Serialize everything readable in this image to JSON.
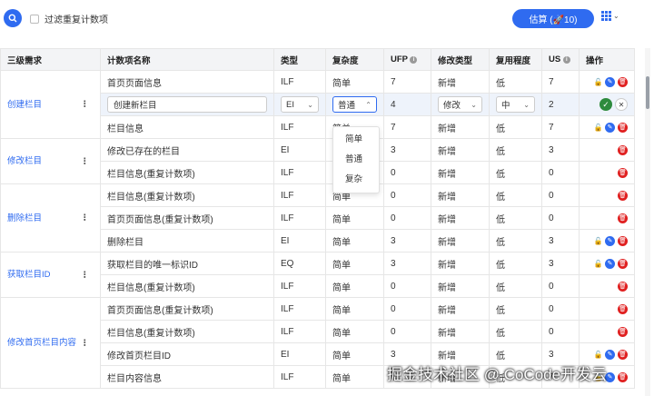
{
  "toolbar": {
    "filter_label": "过滤重复计数项",
    "estimate_label": "估算 (🚀10)"
  },
  "table": {
    "headers": {
      "req": "三级需求",
      "name": "计数项名称",
      "type": "类型",
      "complexity": "复杂度",
      "ufp": "UFP",
      "modify_type": "修改类型",
      "reuse": "复用程度",
      "us": "US",
      "ops": "操作"
    },
    "groups": {
      "g1": "创建栏目",
      "g2": "修改栏目",
      "g3": "删除栏目",
      "g4": "获取栏目ID",
      "g5": "修改首页栏目内容"
    },
    "rows": [
      {
        "name": "首页页面信息",
        "type": "ILF",
        "complexity": "简单",
        "ufp": "7",
        "modify_type": "新增",
        "reuse": "低",
        "us": "7"
      },
      {
        "name": "创建新栏目",
        "type": "EI",
        "complexity": "普通",
        "ufp": "4",
        "modify_type": "修改",
        "reuse": "中",
        "us": "2"
      },
      {
        "name": "栏目信息",
        "type": "ILF",
        "complexity": "简单",
        "ufp": "7",
        "modify_type": "新增",
        "reuse": "低",
        "us": "7"
      },
      {
        "name": "修改已存在的栏目",
        "type": "EI",
        "complexity": "",
        "ufp": "3",
        "modify_type": "新增",
        "reuse": "低",
        "us": "3"
      },
      {
        "name": "栏目信息(重复计数项)",
        "type": "ILF",
        "complexity": "",
        "ufp": "0",
        "modify_type": "新增",
        "reuse": "低",
        "us": "0"
      },
      {
        "name": "栏目信息(重复计数项)",
        "type": "ILF",
        "complexity": "简单",
        "ufp": "0",
        "modify_type": "新增",
        "reuse": "低",
        "us": "0"
      },
      {
        "name": "首页页面信息(重复计数项)",
        "type": "ILF",
        "complexity": "简单",
        "ufp": "0",
        "modify_type": "新增",
        "reuse": "低",
        "us": "0"
      },
      {
        "name": "删除栏目",
        "type": "EI",
        "complexity": "简单",
        "ufp": "3",
        "modify_type": "新增",
        "reuse": "低",
        "us": "3"
      },
      {
        "name": "获取栏目的唯一标识ID",
        "type": "EQ",
        "complexity": "简单",
        "ufp": "3",
        "modify_type": "新增",
        "reuse": "低",
        "us": "3"
      },
      {
        "name": "栏目信息(重复计数项)",
        "type": "ILF",
        "complexity": "简单",
        "ufp": "0",
        "modify_type": "新增",
        "reuse": "低",
        "us": "0"
      },
      {
        "name": "首页页面信息(重复计数项)",
        "type": "ILF",
        "complexity": "简单",
        "ufp": "0",
        "modify_type": "新增",
        "reuse": "低",
        "us": "0"
      },
      {
        "name": "栏目信息(重复计数项)",
        "type": "ILF",
        "complexity": "简单",
        "ufp": "0",
        "modify_type": "新增",
        "reuse": "低",
        "us": "0"
      },
      {
        "name": "修改首页栏目ID",
        "type": "EI",
        "complexity": "简单",
        "ufp": "3",
        "modify_type": "新增",
        "reuse": "低",
        "us": "3"
      },
      {
        "name": "栏目内容信息",
        "type": "ILF",
        "complexity": "简单",
        "ufp": "7",
        "modify_type": "新增",
        "reuse": "低",
        "us": "7"
      }
    ]
  },
  "dropdown": {
    "options": [
      "简单",
      "普通",
      "复杂"
    ]
  },
  "watermark": "掘金技术社区 @ CoCode开发云",
  "colors": {
    "accent": "#2f6bf0",
    "delete": "#e02020",
    "confirm": "#2e8b3d"
  }
}
